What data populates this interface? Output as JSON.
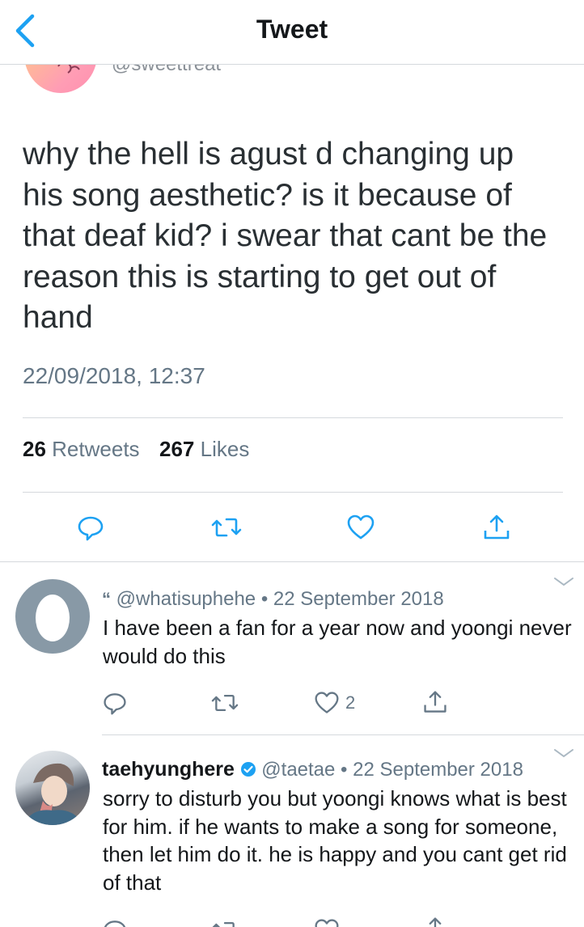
{
  "header": {
    "title": "Tweet"
  },
  "tweet": {
    "handle": "@sweettreat",
    "text": "why the hell is agust d changing up his song aesthetic? is it because of that deaf kid? i swear that cant be the reason this is starting to get out of hand",
    "date": "22/09/2018, 12:37",
    "retweet_count": "26",
    "retweet_label": "Retweets",
    "like_count": "267",
    "like_label": "Likes"
  },
  "replies": [
    {
      "name": "",
      "handle": "@whatisuphehe",
      "date": "22 September 2018",
      "text": "I have been a fan for a year now and yoongi never would do this",
      "like_count": "2"
    },
    {
      "name": "taehyunghere",
      "handle": "@taetae",
      "date": "22 September 2018",
      "text": "sorry to disturb you but yoongi knows what is best for him. if he wants to make a song for someone, then let him do it. he is happy and you cant get rid of that"
    }
  ],
  "icons": {
    "back": "chevron-left-icon",
    "reply": "speech-bubble-icon",
    "retweet": "retweet-icon",
    "like": "heart-icon",
    "share": "share-icon",
    "verified": "verified-badge-icon"
  },
  "colors": {
    "accent": "#1da1f2",
    "muted": "#657786",
    "text": "#14171a"
  }
}
